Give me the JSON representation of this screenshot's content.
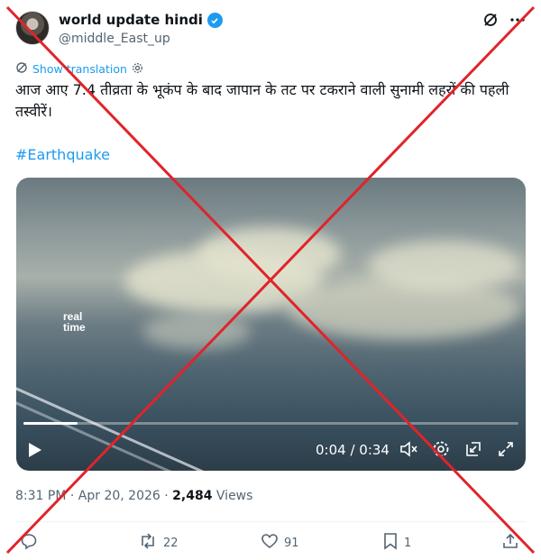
{
  "author": {
    "display_name": "world update hindi",
    "handle": "@middle_East_up",
    "verified": true
  },
  "translate": {
    "label": "Show translation"
  },
  "tweet": {
    "text": "आज आए 7.4 तीव्रता के भूकंप के बाद जापान के तट पर टकराने वाली सुनामी लहरों की पहली तस्वीरें।",
    "hashtag": "#Earthquake"
  },
  "video": {
    "watermark_line1": "real",
    "watermark_line2": "time",
    "time": "0:04 / 0:34",
    "progress": 0.11
  },
  "meta": {
    "time": "8:31 PM",
    "separator1": "·",
    "date": "Apr 20, 2026",
    "separator2": "·",
    "views_count": "2,484",
    "views_label": "Views"
  },
  "actions": {
    "reposts": "22",
    "likes": "91",
    "bookmarks": "1"
  },
  "colors": {
    "accent": "#1d9bf0",
    "secondary_text": "#536471",
    "cross": "#e0242a"
  }
}
